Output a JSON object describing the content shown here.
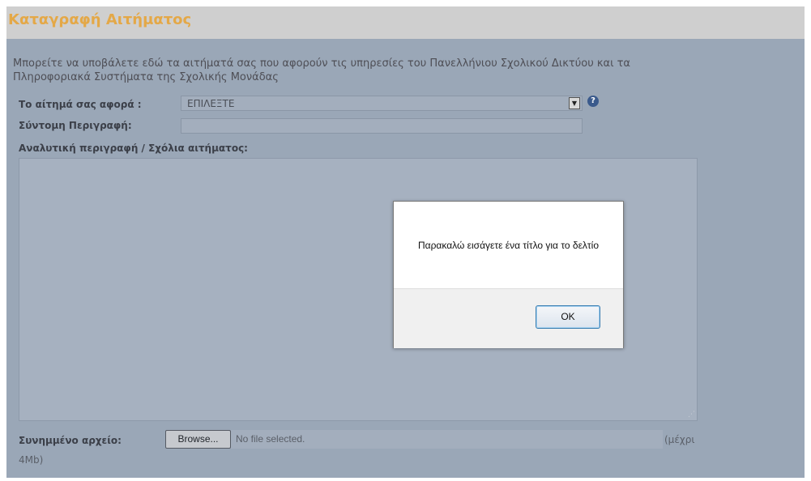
{
  "header": {
    "title": "Καταγραφή Αιτήματος"
  },
  "intro": {
    "line1": "Μπορείτε να υποβάλετε εδώ τα αιτήματά σας που αφορούν τις υπηρεσίες του Πανελλήνιου Σχολικού Δικτύου και τα",
    "line2": "Πληροφοριακά Συστήματα της Σχολικής Μονάδας"
  },
  "form": {
    "topic_label": "Το αίτημά σας αφορά :",
    "topic_value": "ΕΠΙΛΕΞΤΕ",
    "topic_arrow": "▼",
    "help_glyph": "?",
    "short_desc_label": "Σύντομη Περιγραφή:",
    "short_desc_value": "",
    "long_desc_label": "Αναλυτική περιγραφή / Σχόλια αιτήματος:",
    "long_desc_value": "",
    "attachment_label": "Συνημμένο αρχείο:",
    "browse_label": "Browse...",
    "file_status": "No file selected.",
    "size_hint_1": "(μέχρι",
    "size_hint_2": "4Mb)"
  },
  "dialog": {
    "message": "Παρακαλώ εισάγετε ένα τίτλο για το δελτίο",
    "ok_label": "OK"
  },
  "colors": {
    "title": "#e4a847",
    "panel": "#9aa7b7",
    "focus_border": "#3c7fb1"
  }
}
